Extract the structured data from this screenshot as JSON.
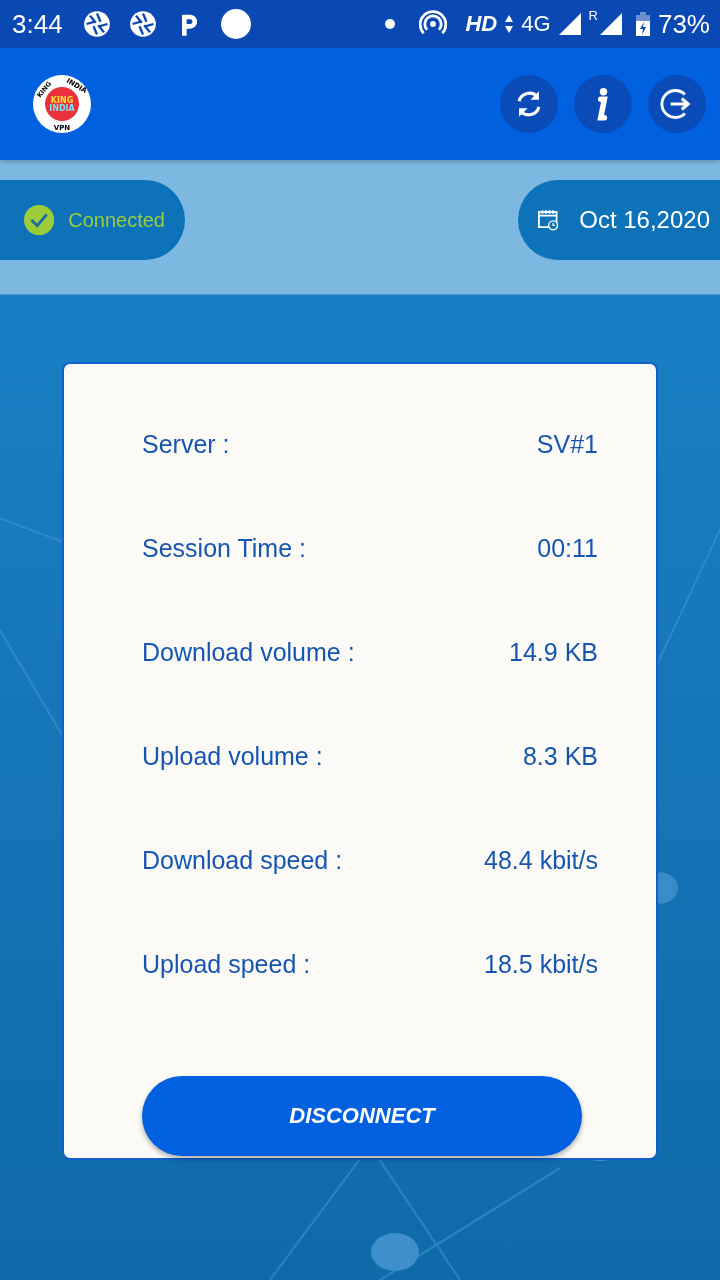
{
  "status_bar": {
    "time": "3:44",
    "network": "HD",
    "data_type": "4G",
    "roaming": "R",
    "battery": "73%"
  },
  "header": {
    "logo": {
      "top_left": "KING",
      "top_right": "INDIA",
      "center_top": "KING",
      "center_bottom": "INDIA",
      "bottom": "VPN"
    }
  },
  "status_pill": {
    "label": "Connected",
    "connected": true
  },
  "date_pill": {
    "label": "Oct 16,2020"
  },
  "stats": [
    {
      "label": "Server :",
      "value": "SV#1"
    },
    {
      "label": "Session Time :",
      "value": "00:11"
    },
    {
      "label": "Download volume :",
      "value": "14.9 KB"
    },
    {
      "label": "Upload volume :",
      "value": "8.3 KB"
    },
    {
      "label": "Download speed :",
      "value": "48.4 kbit/s"
    },
    {
      "label": "Upload speed :",
      "value": "18.5 kbit/s"
    }
  ],
  "disconnect_button": "DISCONNECT"
}
